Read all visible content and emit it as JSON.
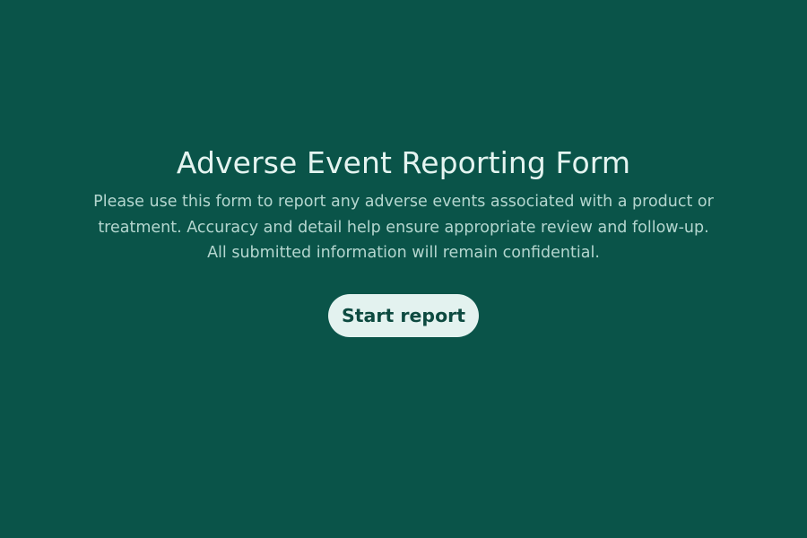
{
  "theme": {
    "background": "#0a5449",
    "title_color": "#e4f4f0",
    "text_color": "#b4d6cf",
    "button_background": "#e3f2ef",
    "button_text_color": "#0d4a40"
  },
  "landing": {
    "title": "Adverse Event Reporting Form",
    "description_lines": [
      "Please use this form to report any adverse events associated with a product or",
      "treatment. Accuracy and detail help ensure appropriate review and follow-up.",
      "All submitted information will remain confidential."
    ],
    "start_button_label": "Start report"
  }
}
